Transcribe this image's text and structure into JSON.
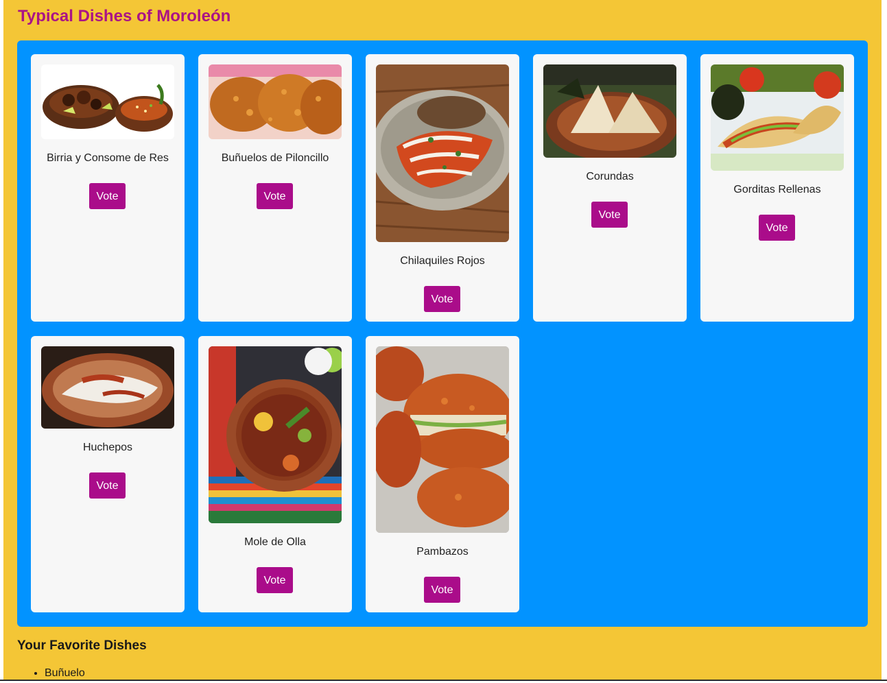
{
  "page": {
    "title": "Typical Dishes of Moroleón"
  },
  "dishes": [
    {
      "name": "Birria y Consome de Res",
      "vote_label": "Vote"
    },
    {
      "name": "Buñuelos de Piloncillo",
      "vote_label": "Vote"
    },
    {
      "name": "Chilaquiles Rojos",
      "vote_label": "Vote"
    },
    {
      "name": "Corundas",
      "vote_label": "Vote"
    },
    {
      "name": "Gorditas Rellenas",
      "vote_label": "Vote"
    },
    {
      "name": "Huchepos",
      "vote_label": "Vote"
    },
    {
      "name": "Mole de Olla",
      "vote_label": "Vote"
    },
    {
      "name": "Pambazos",
      "vote_label": "Vote"
    }
  ],
  "favorites": {
    "heading": "Your Favorite Dishes",
    "items": [
      "Buñuelo"
    ]
  },
  "colors": {
    "page_bg": "#f4c636",
    "panel_bg": "#0293ff",
    "accent": "#aa0c8a",
    "title": "#aa1486"
  }
}
